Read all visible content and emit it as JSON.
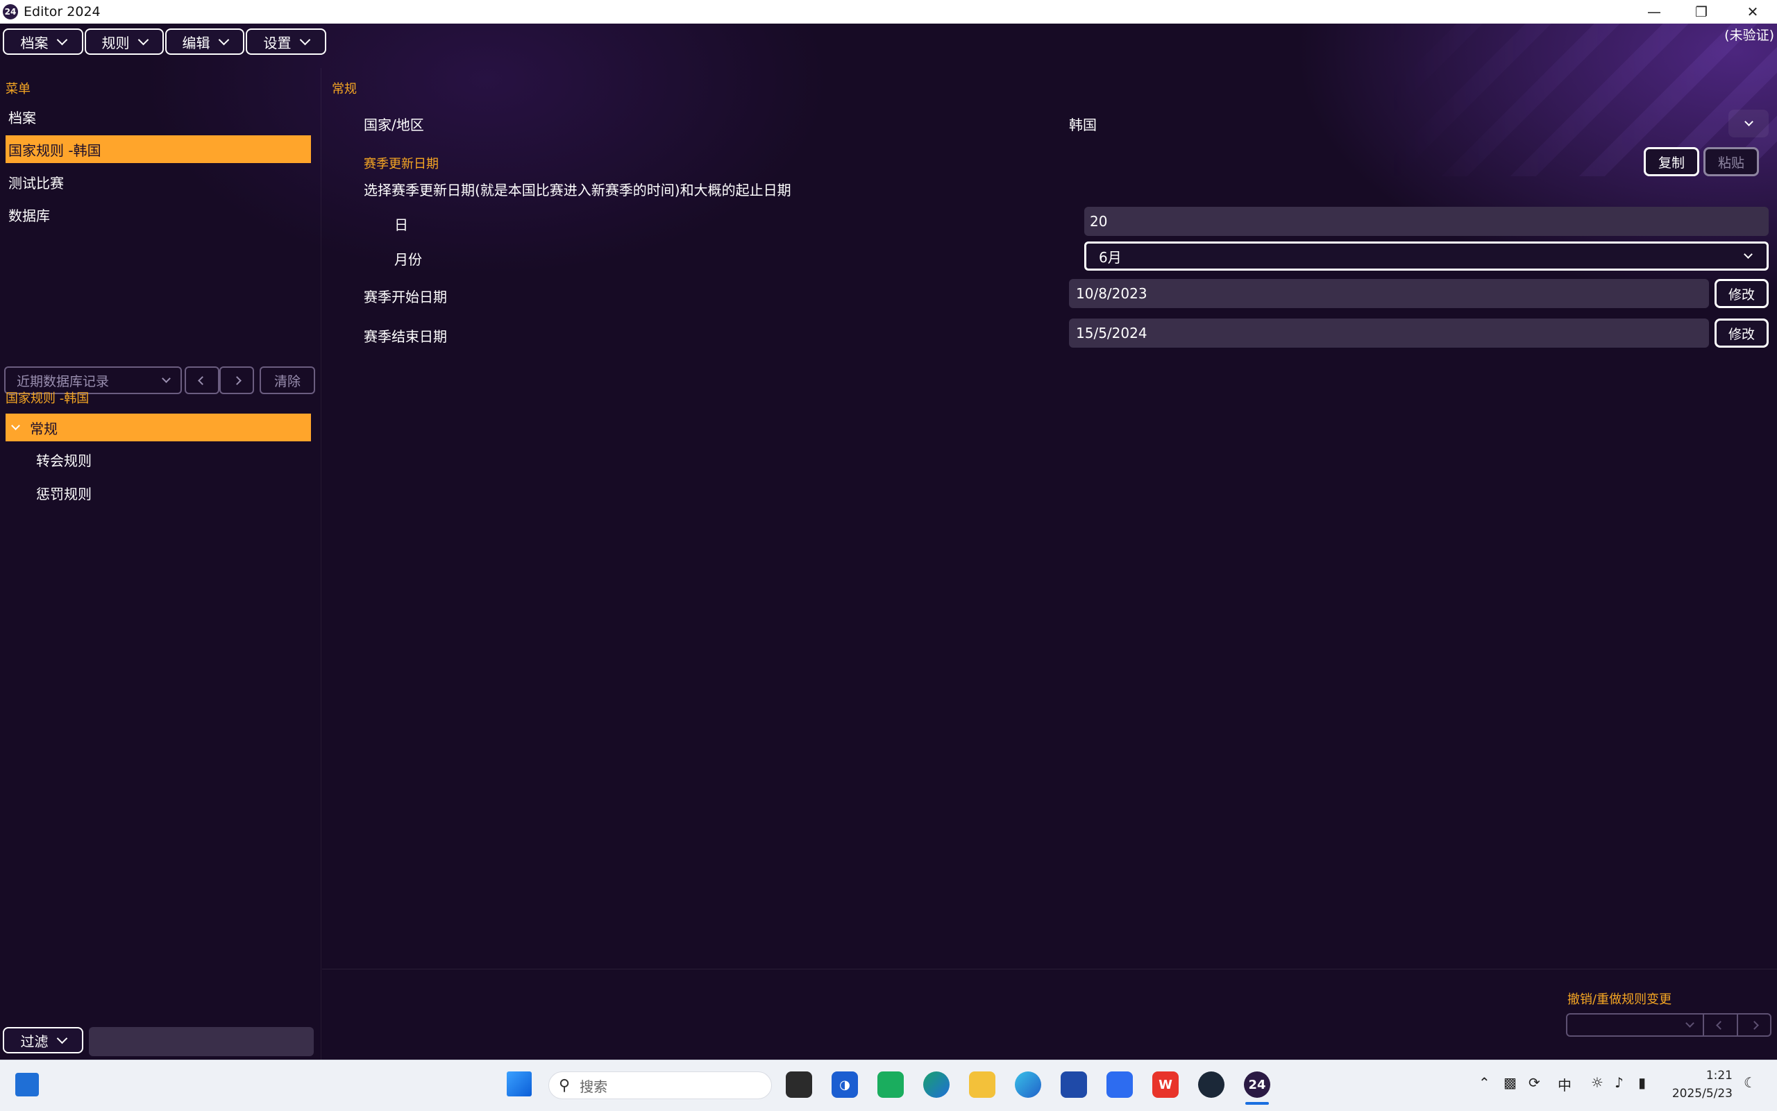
{
  "window": {
    "title": "Editor 2024",
    "app_badge": "24",
    "status": "(未验证)"
  },
  "menubar": [
    {
      "label": "档案"
    },
    {
      "label": "规则"
    },
    {
      "label": "编辑"
    },
    {
      "label": "设置"
    }
  ],
  "sidebar": {
    "menu_title": "菜单",
    "items": [
      {
        "label": "档案"
      },
      {
        "label": "国家规则 -韩国",
        "active": true
      },
      {
        "label": "测试比赛"
      },
      {
        "label": "数据库"
      }
    ],
    "history_placeholder": "近期数据库记录",
    "clear_label": "清除",
    "tree_title": "国家规则 -韩国",
    "tree": [
      {
        "label": "常规",
        "active": true
      },
      {
        "label": "转会规则"
      },
      {
        "label": "惩罚规则"
      }
    ],
    "filter_label": "过滤"
  },
  "main": {
    "section_title": "常规",
    "country_label": "国家/地区",
    "country_value": "韩国",
    "copy_label": "复制",
    "paste_label": "粘贴",
    "season_title": "赛季更新日期",
    "season_desc": "选择赛季更新日期(就是本国比赛进入新赛季的时间)和大概的起止日期",
    "day_label": "日",
    "day_value": "20",
    "month_label": "月份",
    "month_value": "6月",
    "start_label": "赛季开始日期",
    "start_value": "10/8/2023",
    "end_label": "赛季结束日期",
    "end_value": "15/5/2024",
    "edit_label": "修改",
    "undo_title": "撤销/重做规则变更"
  },
  "taskbar": {
    "search_placeholder": "搜索",
    "ime": "中",
    "time": "1:21",
    "date": "2025/5/23"
  },
  "colors": {
    "accent": "#ffa52b",
    "background": "#170b25",
    "field": "#3a2f4a"
  }
}
